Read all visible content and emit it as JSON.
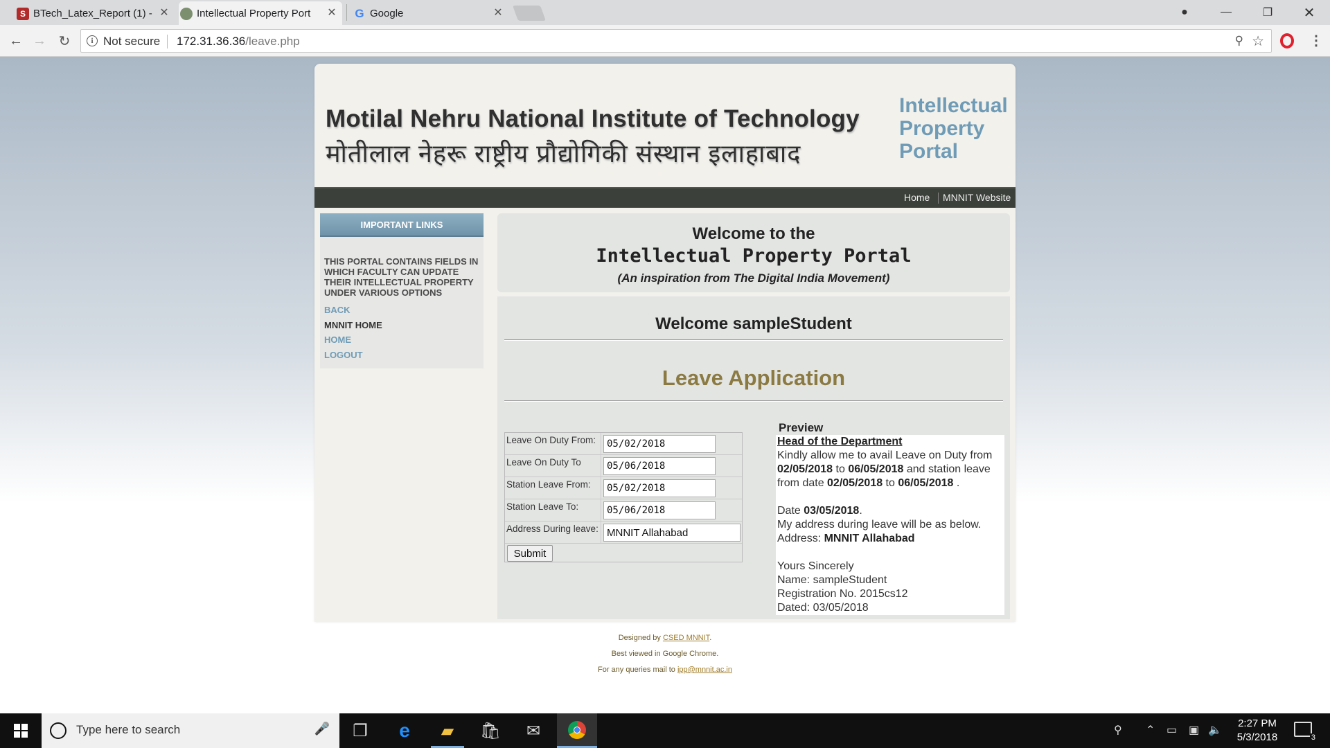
{
  "browser": {
    "tabs": [
      {
        "title": "BTech_Latex_Report (1) -",
        "favicon": "S"
      },
      {
        "title": "Intellectual Property Port",
        "favicon": "ip-logo"
      },
      {
        "title": "Google",
        "favicon": "G"
      }
    ],
    "security_label": "Not secure",
    "url_host": "172.31.36.36",
    "url_path": "/leave.php"
  },
  "header": {
    "institute_en": "Motilal Nehru National Institute of Technology",
    "institute_hi": "मोतीलाल नेहरू राष्ट्रीय प्रौद्योगिकी संस्थान इलाहाबाद",
    "portal_line1": "Intellectual",
    "portal_line2": "Property",
    "portal_line3": "Portal"
  },
  "topnav": {
    "home": "Home",
    "mnnit_website": "MNNIT Website"
  },
  "sidebar": {
    "heading": "IMPORTANT LINKS",
    "description": "THIS PORTAL CONTAINS FIELDS IN WHICH FACULTY CAN UPDATE THEIR INTELLECTUAL PROPERTY UNDER VARIOUS OPTIONS",
    "links": [
      "BACK",
      "MNNIT HOME",
      "HOME",
      "LOGOUT"
    ]
  },
  "welcome": {
    "line1": "Welcome to the",
    "line2": "Intellectual Property Portal",
    "line3": "(An inspiration from The Digital India Movement)"
  },
  "content": {
    "user_greeting": "Welcome sampleStudent",
    "title": "Leave Application"
  },
  "form": {
    "leave_from_label": "Leave On Duty From:",
    "leave_from_value": "05/02/2018",
    "leave_to_label": "Leave On Duty To",
    "leave_to_value": "05/06/2018",
    "station_from_label": "Station Leave From:",
    "station_from_value": "05/02/2018",
    "station_to_label": "Station Leave To:",
    "station_to_value": "05/06/2018",
    "address_label": "Address During leave:",
    "address_value": "MNNIT Allahabad",
    "submit_label": "Submit"
  },
  "preview": {
    "heading": "Preview",
    "to": "Head of the Department",
    "t1": "Kindly allow me to avail Leave on Duty from ",
    "d1": "02/05/2018",
    "t2": " to ",
    "d2": "06/05/2018",
    "t3": " and station leave from date ",
    "d3": "02/05/2018",
    "t4": " to ",
    "d4": "06/05/2018",
    "t5": " .",
    "date_label": "Date ",
    "date_value": "03/05/2018",
    "date_end": ".",
    "address_intro": "My address during leave will be as below.",
    "address_label": "Address: ",
    "address_value": "MNNIT Allahabad",
    "closing": "Yours Sincerely",
    "name_line": "Name: sampleStudent",
    "reg_line": "Registration No. 2015cs12",
    "dated_line": "Dated: 03/05/2018"
  },
  "footer": {
    "designed_by": "Designed by ",
    "designed_link": "CSED MNNIT",
    "designed_end": ".",
    "best_viewed": "Best viewed in Google Chrome.",
    "queries": "For any queries mail to ",
    "email": "ipp@mnnit.ac.in"
  },
  "taskbar": {
    "search_placeholder": "Type here to search",
    "time": "2:27 PM",
    "date": "5/3/2018",
    "notification_count": "3"
  }
}
